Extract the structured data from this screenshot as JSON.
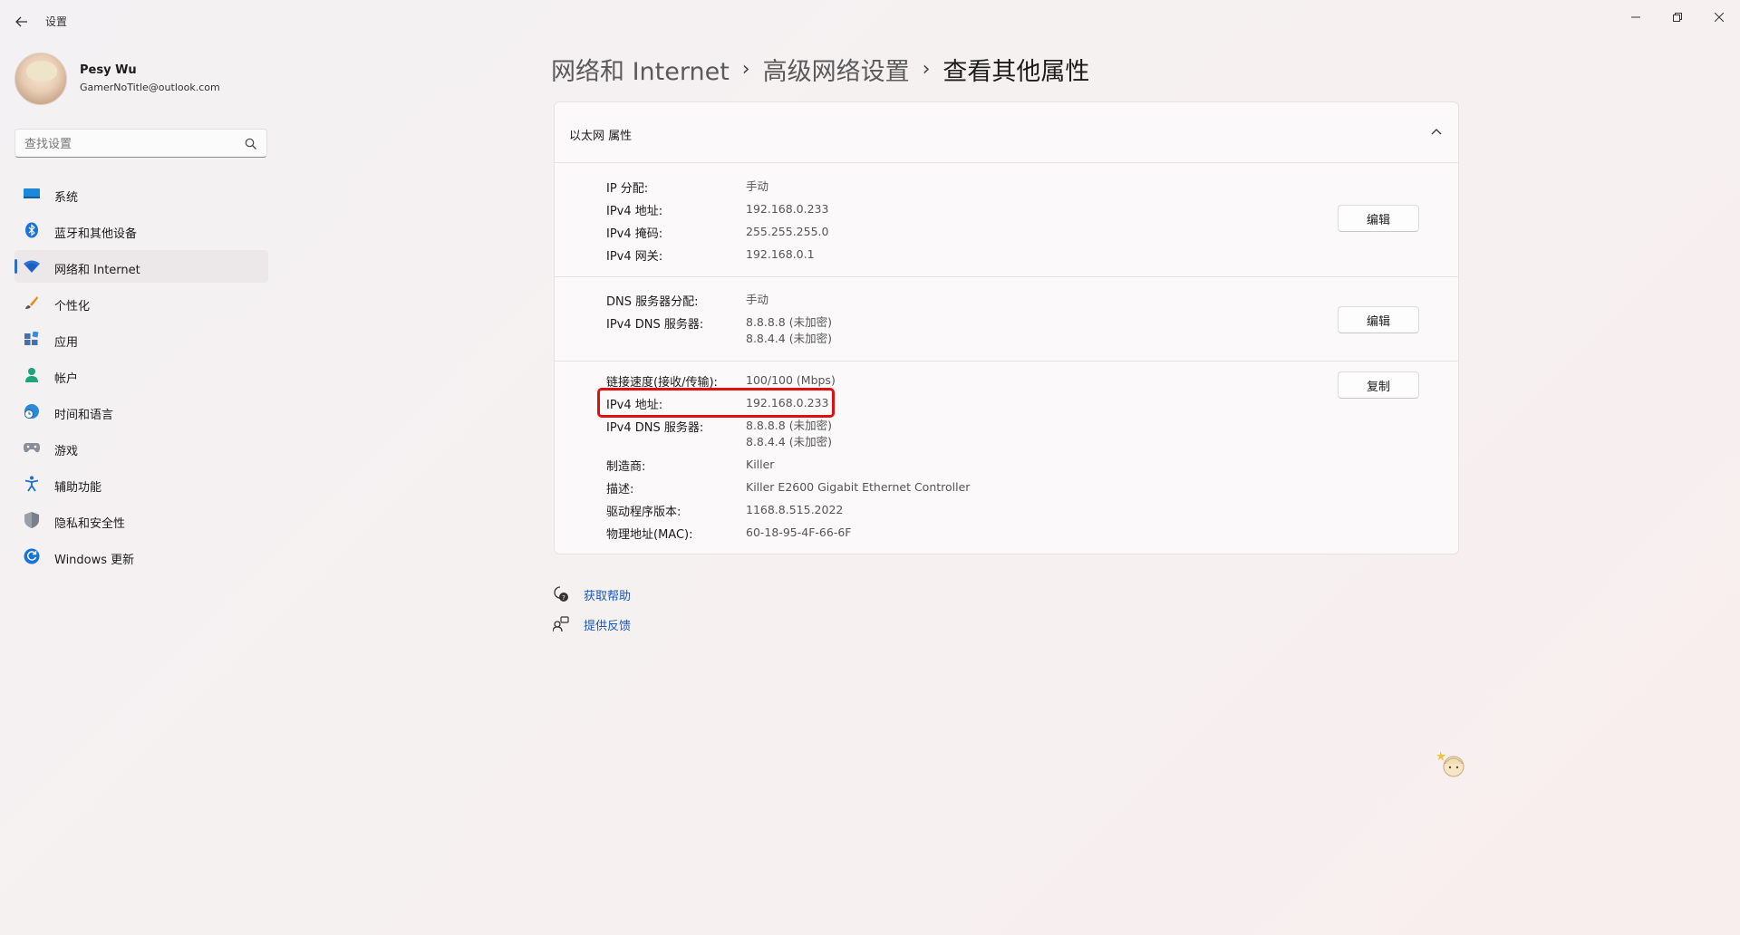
{
  "window": {
    "title": "设置",
    "back_icon": "back-arrow-icon",
    "controls": {
      "minimize": "—",
      "maximize": "❐",
      "close": "✕"
    }
  },
  "profile": {
    "name": "Pesy Wu",
    "email": "GamerNoTitle@outlook.com"
  },
  "search": {
    "placeholder": "查找设置"
  },
  "sidebar": {
    "items": [
      {
        "label": "系统",
        "icon": "system-icon",
        "selected": false
      },
      {
        "label": "蓝牙和其他设备",
        "icon": "bluetooth-icon",
        "selected": false
      },
      {
        "label": "网络和 Internet",
        "icon": "wifi-icon",
        "selected": true
      },
      {
        "label": "个性化",
        "icon": "brush-icon",
        "selected": false
      },
      {
        "label": "应用",
        "icon": "apps-icon",
        "selected": false
      },
      {
        "label": "帐户",
        "icon": "account-icon",
        "selected": false
      },
      {
        "label": "时间和语言",
        "icon": "globe-clock-icon",
        "selected": false
      },
      {
        "label": "游戏",
        "icon": "gamepad-icon",
        "selected": false
      },
      {
        "label": "辅助功能",
        "icon": "accessibility-icon",
        "selected": false
      },
      {
        "label": "隐私和安全性",
        "icon": "shield-icon",
        "selected": false
      },
      {
        "label": "Windows 更新",
        "icon": "update-icon",
        "selected": false
      }
    ],
    "accent_color": "#2f6ecc"
  },
  "breadcrumb": {
    "items": [
      "网络和 Internet",
      "高级网络设置",
      "查看其他属性"
    ],
    "separator": "›"
  },
  "card": {
    "title": "以太网 属性",
    "ip_section": {
      "rows": [
        {
          "label": "IP 分配:",
          "value": "手动"
        },
        {
          "label": "IPv4 地址:",
          "value": "192.168.0.233"
        },
        {
          "label": "IPv4 掩码:",
          "value": "255.255.255.0"
        },
        {
          "label": "IPv4 网关:",
          "value": "192.168.0.1"
        }
      ],
      "button": "编辑"
    },
    "dns_section": {
      "rows": [
        {
          "label": "DNS 服务器分配:",
          "value": "手动"
        },
        {
          "label": "IPv4 DNS 服务器:",
          "value": "8.8.8.8 (未加密)",
          "value2": "8.8.4.4 (未加密)"
        }
      ],
      "button": "编辑"
    },
    "info_section": {
      "rows": [
        {
          "label": "链接速度(接收/传输):",
          "value": "100/100 (Mbps)"
        },
        {
          "label": "IPv4 地址:",
          "value": "192.168.0.233"
        },
        {
          "label": "IPv4 DNS 服务器:",
          "value": "8.8.8.8 (未加密)",
          "value2": "8.8.4.4 (未加密)"
        },
        {
          "label": "制造商:",
          "value": "Killer"
        },
        {
          "label": "描述:",
          "value": "Killer E2600 Gigabit Ethernet Controller"
        },
        {
          "label": "驱动程序版本:",
          "value": "1168.8.515.2022"
        },
        {
          "label": "物理地址(MAC):",
          "value": "60-18-95-4F-66-6F"
        }
      ],
      "button": "复制"
    },
    "highlight_color": "#e01010"
  },
  "links": [
    {
      "label": "获取帮助",
      "icon": "help-icon"
    },
    {
      "label": "提供反馈",
      "icon": "feedback-icon"
    }
  ],
  "link_color": "#1a57b8"
}
